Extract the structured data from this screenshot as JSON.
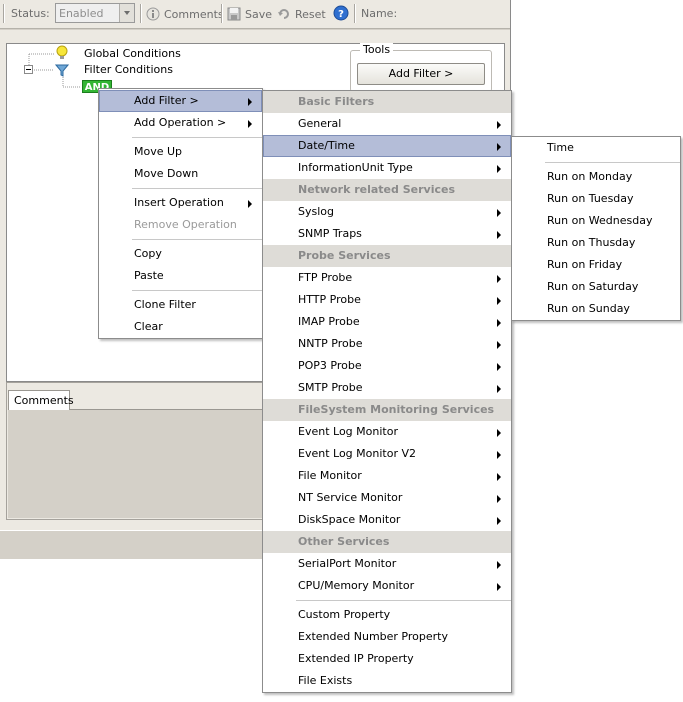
{
  "toolbar": {
    "status_label": "Status:",
    "status_value": "Enabled",
    "comments_label": "Comments",
    "save_label": "Save",
    "reset_label": "Reset",
    "name_label": "Name:"
  },
  "tree": {
    "global_conditions": "Global Conditions",
    "filter_conditions": "Filter Conditions",
    "and_node": "AND"
  },
  "tools": {
    "title": "Tools",
    "add_filter_button": "Add Filter >"
  },
  "comments_tab": "Comments",
  "context_menu": {
    "items": [
      {
        "label": "Add Filter >",
        "submenu": true,
        "selected": true
      },
      {
        "label": "Add Operation >",
        "submenu": true
      },
      {
        "label": "Move Up"
      },
      {
        "label": "Move Down"
      },
      {
        "label": "Insert Operation",
        "submenu": true
      },
      {
        "label": "Remove Operation",
        "disabled": true
      },
      {
        "label": "Copy"
      },
      {
        "label": "Paste"
      },
      {
        "label": "Clone Filter"
      },
      {
        "label": "Clear"
      }
    ]
  },
  "filter_menu": {
    "basic_header": "Basic Filters",
    "general": "General",
    "datetime": "Date/Time",
    "infounit": "InformationUnit Type",
    "network_header": "Network related Services",
    "syslog": "Syslog",
    "snmp": "SNMP Traps",
    "probe_header": "Probe Services",
    "ftp": "FTP Probe",
    "http": "HTTP Probe",
    "imap": "IMAP Probe",
    "nntp": "NNTP Probe",
    "pop3": "POP3 Probe",
    "smtp": "SMTP Probe",
    "fs_header": "FileSystem Monitoring Services",
    "eventlog": "Event Log Monitor",
    "eventlog2": "Event Log Monitor V2",
    "filemon": "File Monitor",
    "ntservice": "NT Service Monitor",
    "diskspace": "DiskSpace Monitor",
    "other_header": "Other Services",
    "serialport": "SerialPort Monitor",
    "cpumem": "CPU/Memory Monitor",
    "custom": "Custom Property",
    "extnum": "Extended Number Property",
    "extip": "Extended IP Property",
    "fileexists": "File Exists"
  },
  "date_menu": {
    "time": "Time",
    "monday": "Run on Monday",
    "tuesday": "Run on Tuesday",
    "wednesday": "Run on Wednesday",
    "thursday": "Run on Thusday",
    "friday": "Run on Friday",
    "saturday": "Run on Saturday",
    "sunday": "Run on Sunday"
  },
  "colors": {
    "selection": "#b4bdd8",
    "and_node": "#33b534",
    "header_bg": "#dedcd7"
  }
}
